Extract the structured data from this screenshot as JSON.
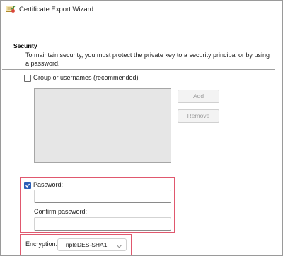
{
  "window": {
    "title": "Certificate Export Wizard",
    "icon": "certificate-wizard-icon"
  },
  "security": {
    "heading": "Security",
    "description": "To maintain security, you must protect the private key to a security principal or by using a password."
  },
  "group_option": {
    "label": "Group or usernames (recommended)",
    "checked": false,
    "principals": [],
    "add_label": "Add",
    "remove_label": "Remove"
  },
  "password_option": {
    "label": "Password:",
    "checked": true,
    "password_value": "",
    "confirm_label": "Confirm password:",
    "confirm_value": ""
  },
  "encryption": {
    "label": "Encryption:",
    "selected": "TripleDES-SHA1"
  },
  "colors": {
    "highlight_border": "#e0586e",
    "checkbox_checked": "#2b5fb7",
    "listbox_bg": "#e6e6e6"
  }
}
